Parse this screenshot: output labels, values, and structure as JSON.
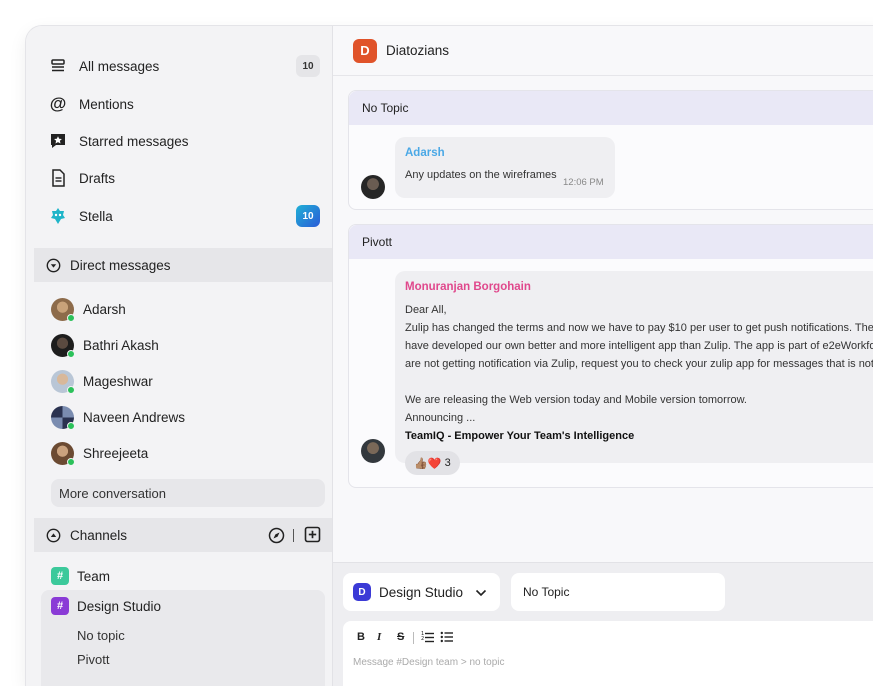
{
  "sidebar": {
    "nav": [
      {
        "label": "All messages",
        "icon": "inbox-icon",
        "count": "10"
      },
      {
        "label": "Mentions",
        "icon": "at-icon"
      },
      {
        "label": "Starred messages",
        "icon": "star-icon"
      },
      {
        "label": "Drafts",
        "icon": "document-icon"
      },
      {
        "label": "Stella",
        "icon": "bot-icon",
        "count": "10"
      }
    ],
    "direct_messages": {
      "title": "Direct messages",
      "people": [
        {
          "name": "Adarsh"
        },
        {
          "name": "Bathri Akash"
        },
        {
          "name": "Mageshwar"
        },
        {
          "name": "Naveen Andrews"
        },
        {
          "name": "Shreejeeta"
        }
      ],
      "more_label": "More conversation"
    },
    "channels": {
      "title": "Channels",
      "items": [
        {
          "name": "Team",
          "color": "#3cc99b"
        },
        {
          "name": "Design Studio",
          "color": "#8a3bd6"
        }
      ],
      "topics": [
        "No topic",
        "Pivott"
      ]
    }
  },
  "header": {
    "workspace_initial": "D",
    "workspace_name": "Diatozians"
  },
  "feed": [
    {
      "topic": "No Topic",
      "sender": "Adarsh",
      "sender_color": "#4aa8e6",
      "lines": [
        "Any updates on the wireframes"
      ],
      "time": "12:06 PM"
    },
    {
      "topic": "Pivott",
      "sender": "Monuranjan Borgohain",
      "sender_color": "#e0488c",
      "lines": [
        "Dear All,",
        "Zulip has changed the terms and now we have to pay $10 per user to get push notifications. The",
        "have developed our own better and more intelligent app than Zulip. The app is part of e2eWorkfor",
        "are not getting notification via Zulip, request you to check your zulip app for messages that is not r",
        "",
        "We are releasing the Web version today and Mobile version tomorrow.",
        "Announcing ..."
      ],
      "bold_line": "TeamIQ - Empower Your Team's Intelligence",
      "reaction": {
        "emojis": "👍🏽❤️",
        "count": "3"
      }
    }
  ],
  "composer": {
    "stream_initial": "D",
    "stream_name": "Design Studio",
    "topic_value": "No Topic",
    "format_buttons": [
      "B",
      "I",
      "S"
    ],
    "placeholder": "Message #Design team > no topic"
  }
}
